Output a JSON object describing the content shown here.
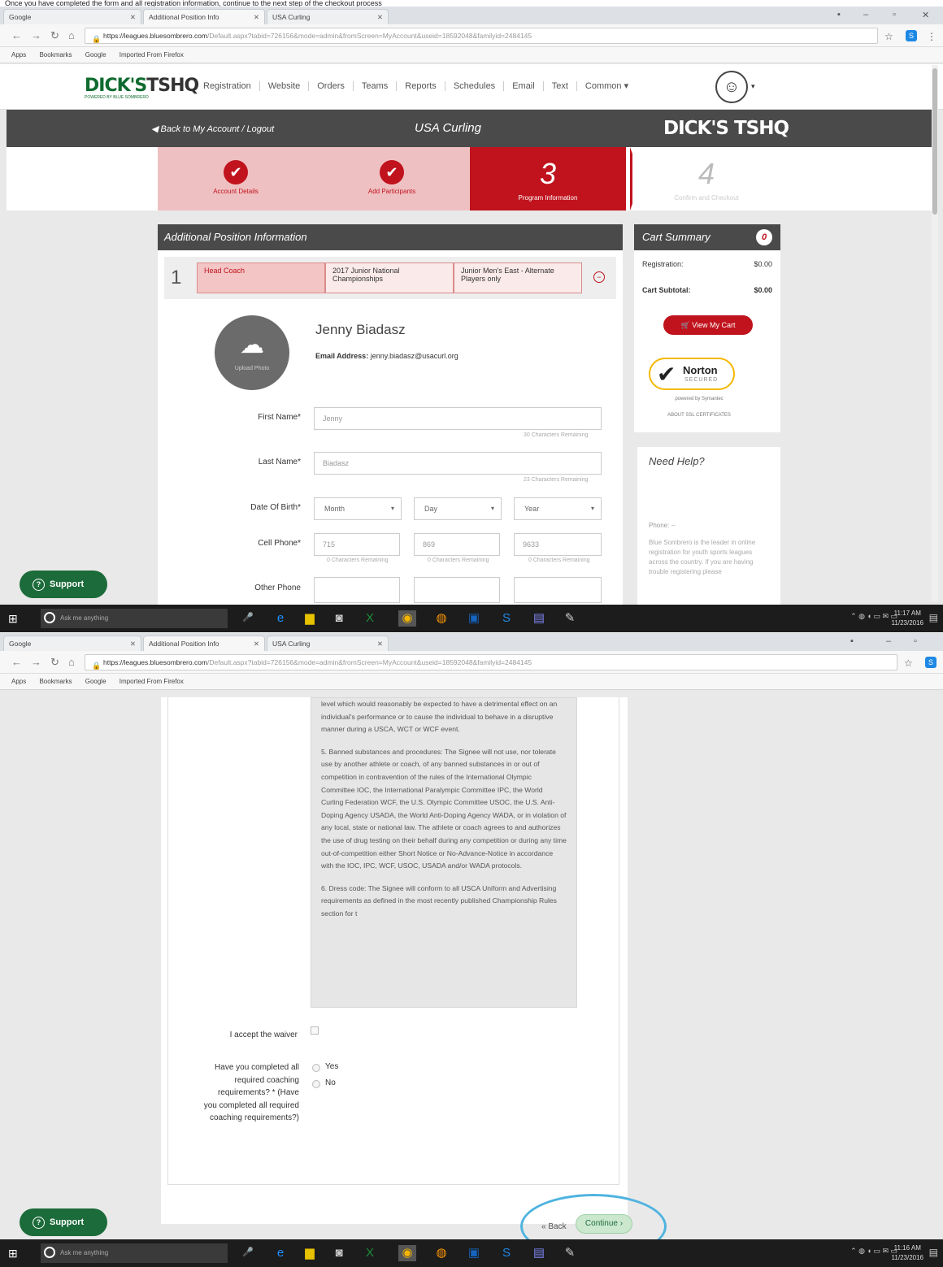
{
  "top_cut_text": "Once you have completed the form and all registration information, continue to the next step of the checkout process",
  "browser": {
    "tabs": [
      {
        "label": "Google"
      },
      {
        "label": "Additional Position Info"
      },
      {
        "label": "USA Curling"
      }
    ],
    "url_host": "https://leagues.bluesombrero.com",
    "url_path1": "/Default.aspx?tabid=726156&mode=admin&fromScreen=MyAccount&useid=18592048&familyid=2484145",
    "url_path2": "/Default.aspx?tabid=726156&mode=admin&fromScreen=MyAccount&useid=18592048&familyid=2484145",
    "bookmarks": [
      "Apps",
      "Bookmarks",
      "Google",
      "Imported From Firefox"
    ]
  },
  "nav": {
    "logo_left": "DICK'S",
    "logo_right": "TSHQ",
    "tagline": "POWERED BY BLUE SOMBRERO",
    "menu": [
      "Registration",
      "Website",
      "Orders",
      "Teams",
      "Reports",
      "Schedules",
      "Email",
      "Text",
      "Common ▾"
    ]
  },
  "header": {
    "back_link": "Back to My Account / Logout",
    "org": "USA Curling",
    "logo": "DICK'S TSHQ"
  },
  "steps": [
    {
      "label": "Account Details"
    },
    {
      "label": "Add Participants"
    },
    {
      "number": "3",
      "label": "Program Information"
    },
    {
      "number": "4",
      "label": "Confirm and Checkout"
    }
  ],
  "section_title": "Additional Position Information",
  "position": {
    "index": "1",
    "role": "Head Coach",
    "event": "2017 Junior National Championships",
    "division": "Junior Men's East - Alternate Players only"
  },
  "profile": {
    "upload_label": "Upload Photo",
    "name": "Jenny Biadasz",
    "email_label": "Email Address:",
    "email": "jenny.biadasz@usacurl.org"
  },
  "form": {
    "first_name_label": "First Name*",
    "first_name_value": "Jenny",
    "first_name_hint": "30 Characters Remaining",
    "last_name_label": "Last Name*",
    "last_name_value": "Biadasz",
    "last_name_hint": "23 Characters Remaining",
    "dob_label": "Date Of Birth*",
    "dob_month": "Month",
    "dob_day": "Day",
    "dob_year": "Year",
    "cell_label": "Cell Phone*",
    "cell_1": "715",
    "cell_2": "869",
    "cell_3": "9633",
    "cell_hint": "0 Characters Remaining",
    "other_label": "Other Phone"
  },
  "cart": {
    "title": "Cart Summary",
    "count": "0",
    "registration_label": "Registration:",
    "registration_value": "$0.00",
    "subtotal_label": "Cart Subtotal:",
    "subtotal_value": "$0.00",
    "view_button": "View My Cart",
    "norton": "Norton",
    "norton_secured": "SECURED",
    "norton_by": "powered by Symantec",
    "norton_about": "ABOUT SSL CERTIFICATES"
  },
  "help": {
    "title": "Need Help?",
    "phone": "Phone: --",
    "text": "Blue Sombrero is the leader in online registration for youth sports leagues across the country. If you are having trouble registering please"
  },
  "support_label": "Support",
  "taskbar": {
    "search": "Ask me anything",
    "time1": "11:17 AM",
    "date1": "11/23/2016",
    "time2": "11:16 AM",
    "date2": "11/23/2016"
  },
  "waiver": {
    "p1": "level which would reasonably be expected to have a detrimental effect on an individual's performance or to cause the individual to behave in a disruptive manner during a USCA, WCT or WCF event.",
    "p2": "5. Banned substances and procedures: The Signee will not use, nor tolerate use by another athlete or coach, of any banned substances in or out of competition in contravention of the rules of the International Olympic Committee IOC, the International Paralympic Committee IPC, the World Curling Federation WCF, the U.S. Olympic Committee USOC, the U.S. Anti-Doping Agency USADA, the World Anti-Doping Agency WADA, or in violation of any local, state or national law. The athlete or coach agrees to and authorizes the use of drug testing on their behalf during any competition or during any time out-of-competition either Short Notice or No-Advance-Notice in accordance with the IOC, IPC, WCF, USOC, USADA and/or WADA protocols.",
    "p3": "6. Dress code: The Signee will conform to all USCA Uniform and Advertising requirements as defined in the most recently published Championship Rules section for t"
  },
  "accept_label": "I accept the waiver",
  "question": "Have you completed all required coaching requirements? * (Have you completed all required coaching requirements?)",
  "yes_label": "Yes",
  "no_label": "No",
  "back_button": "« Back",
  "continue_button": "Continue ›"
}
